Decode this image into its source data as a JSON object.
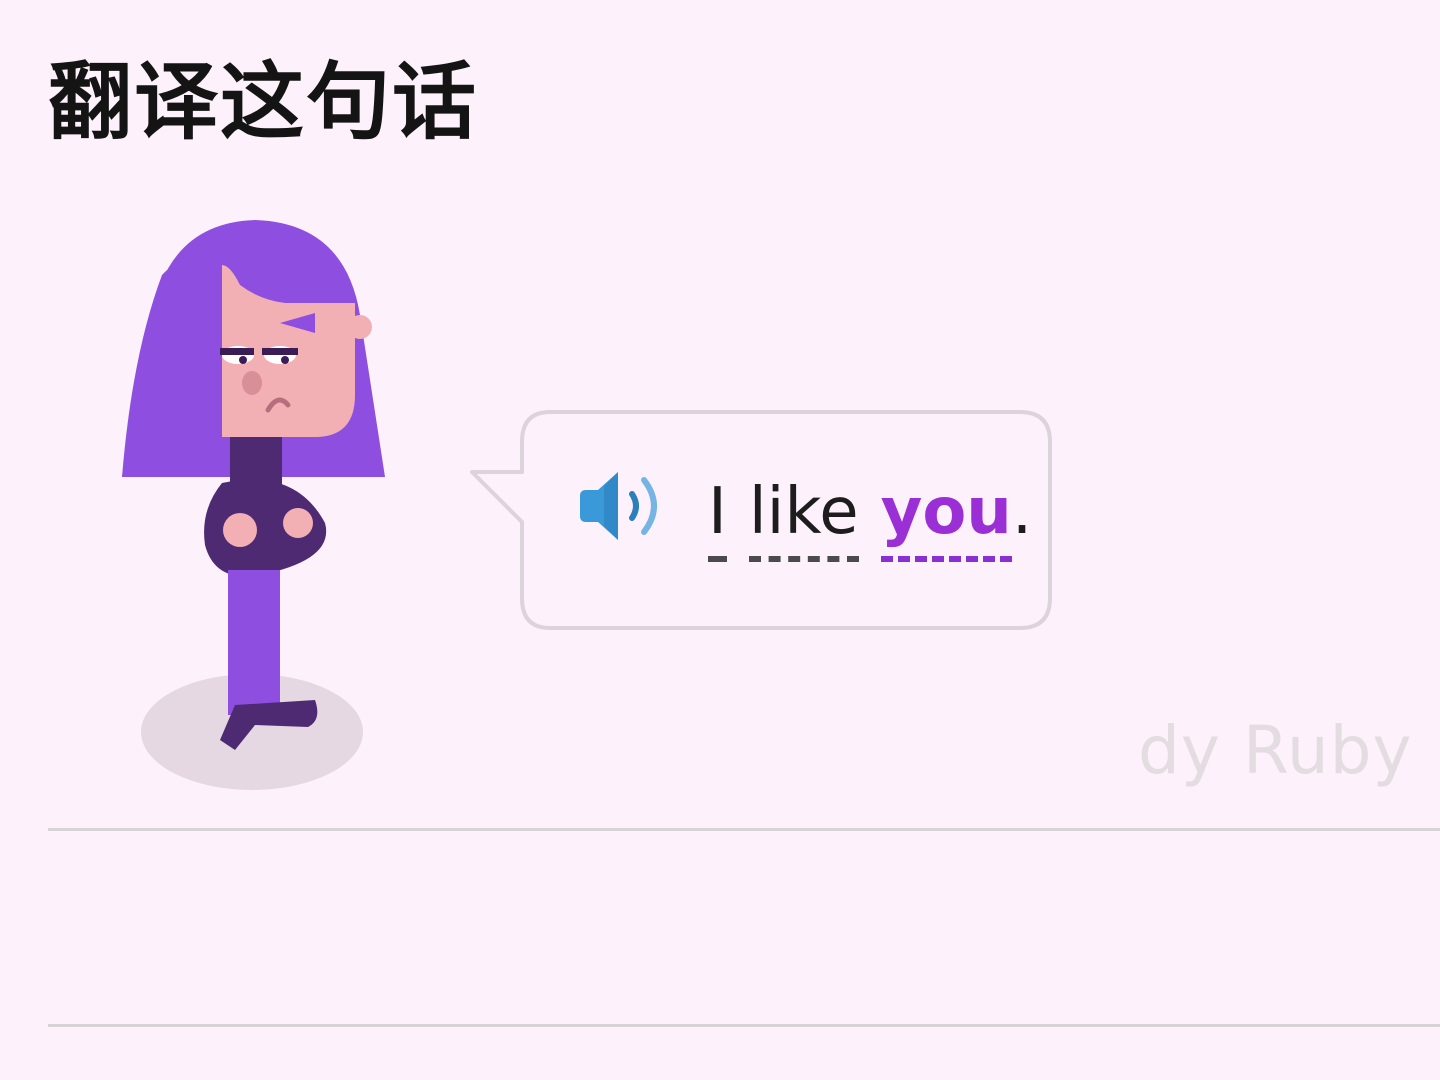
{
  "prompt": {
    "title": "翻译这句话"
  },
  "exercise": {
    "speaker_icon": "speaker-audio-icon",
    "sentence": [
      {
        "text": "I",
        "hint": false
      },
      {
        "text": "like",
        "hint": false
      },
      {
        "text": "you",
        "hint": true
      }
    ],
    "punctuation": ".",
    "character_icon": "lily-character-illustration"
  },
  "watermark": {
    "text": "dy Ruby"
  },
  "colors": {
    "background": "#fdf1fb",
    "hint_word": "#9b2fd6",
    "character_hair": "#8e4fe0",
    "speaker": "#3a9ad9"
  }
}
